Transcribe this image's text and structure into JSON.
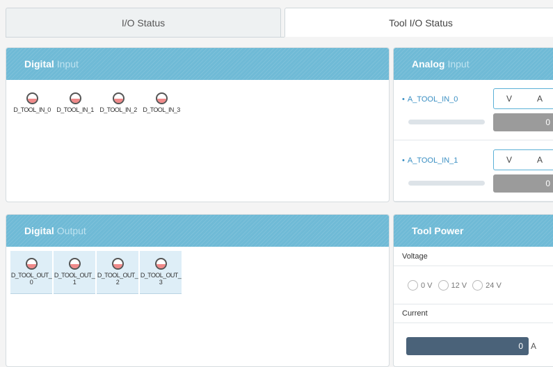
{
  "tabs": [
    {
      "label": "I/O Status"
    },
    {
      "label": "Tool I/O Status"
    }
  ],
  "digital_input": {
    "title_strong": "Digital",
    "title_light": "Input",
    "items": [
      {
        "label": "D_TOOL_IN_0"
      },
      {
        "label": "D_TOOL_IN_1"
      },
      {
        "label": "D_TOOL_IN_2"
      },
      {
        "label": "D_TOOL_IN_3"
      }
    ]
  },
  "analog_input": {
    "title_strong": "Analog",
    "title_light": "Input",
    "channels": [
      {
        "name": "A_TOOL_IN_0",
        "unit_v": "V",
        "unit_a": "A",
        "value": "0"
      },
      {
        "name": "A_TOOL_IN_1",
        "unit_v": "V",
        "unit_a": "A",
        "value": "0"
      }
    ]
  },
  "digital_output": {
    "title_strong": "Digital",
    "title_light": "Output",
    "items": [
      {
        "label": "D_TOOL_OUT_0"
      },
      {
        "label": "D_TOOL_OUT_1"
      },
      {
        "label": "D_TOOL_OUT_2"
      },
      {
        "label": "D_TOOL_OUT_3"
      }
    ]
  },
  "tool_power": {
    "title": "Tool Power",
    "voltage_label": "Voltage",
    "voltage_options": [
      {
        "label": "0 V"
      },
      {
        "label": "12 V"
      },
      {
        "label": "24 V"
      }
    ],
    "current_label": "Current",
    "current_value": "0",
    "current_unit": "A"
  },
  "colors": {
    "header": "#6fbad6",
    "led_off": "#f08a8a",
    "analog_name": "#3a8fc3",
    "current_box": "#4a6279"
  }
}
